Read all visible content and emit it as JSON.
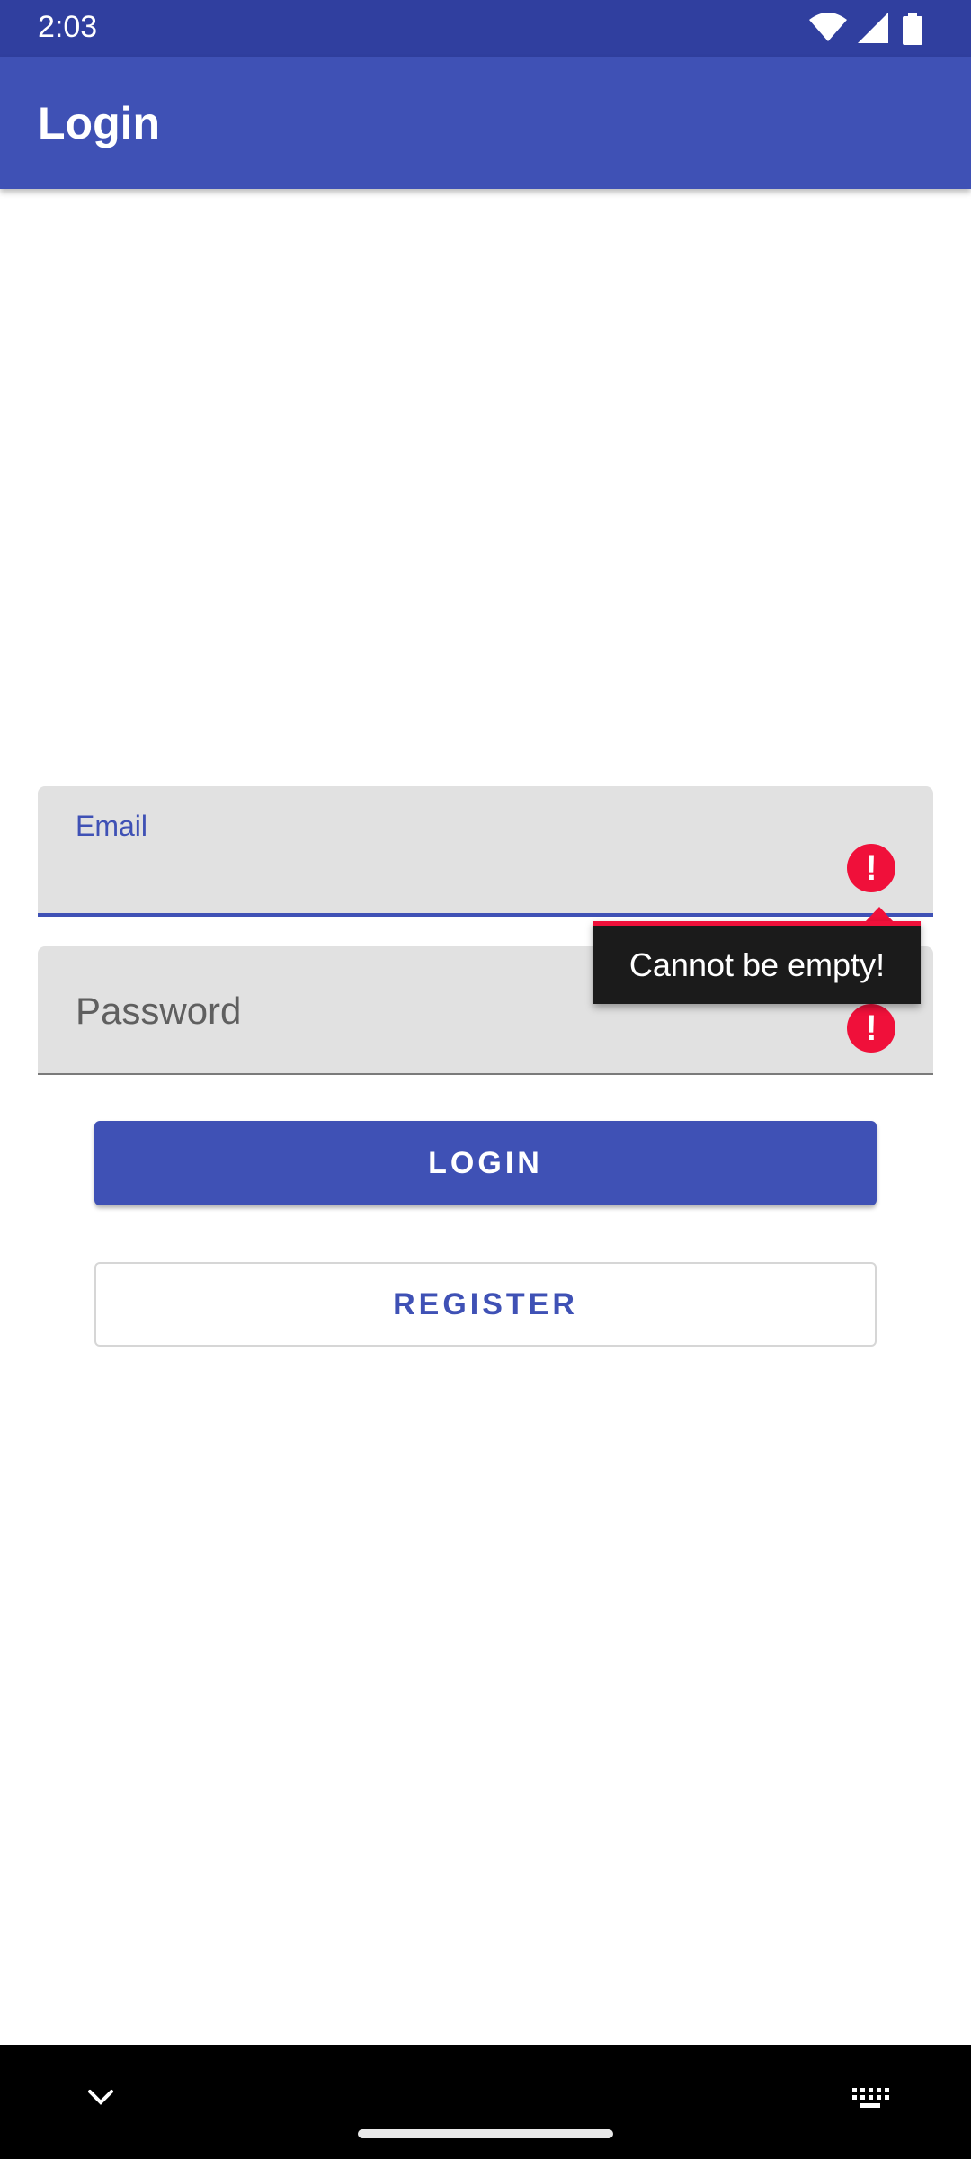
{
  "status_bar": {
    "time": "2:03",
    "icons": [
      "wifi-icon",
      "cellular-signal-icon",
      "battery-icon"
    ]
  },
  "app_bar": {
    "title": "Login"
  },
  "form": {
    "email": {
      "label": "Email",
      "value": "",
      "error": true
    },
    "password": {
      "placeholder": "Password",
      "value": "",
      "error": true
    },
    "error_tooltip": "Cannot be empty!",
    "login_button": "LOGIN",
    "register_button": "REGISTER"
  },
  "nav_bar": {
    "icons": [
      "chevron-down-icon",
      "home-handle",
      "keyboard-icon"
    ]
  },
  "colors": {
    "primary": "#3F51B5",
    "primary_dark": "#303F9F",
    "error": "#F0103A",
    "field_bg": "#E1E1E1"
  }
}
